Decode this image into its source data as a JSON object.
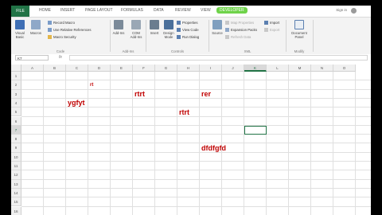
{
  "tabs": [
    "FILE",
    "HOME",
    "INSERT",
    "PAGE LAYOUT",
    "FORMULAS",
    "DATA",
    "REVIEW",
    "VIEW",
    "DEVELOPER"
  ],
  "account": {
    "signin": "Sign in"
  },
  "ribbon": {
    "code": {
      "visual_basic": "Visual Basic",
      "macros": "Macros",
      "record_macro": "Record Macro",
      "relative_refs": "Use Relative References",
      "macro_security": "Macro Security",
      "group": "Code"
    },
    "addins": {
      "addins": "Add-Ins",
      "com_addins": "COM Add-Ins",
      "group": "Add-Ins"
    },
    "controls": {
      "insert": "Insert",
      "design_mode": "Design Mode",
      "properties": "Properties",
      "view_code": "View Code",
      "run_dialog": "Run Dialog",
      "group": "Controls"
    },
    "xml": {
      "source": "Source",
      "map_properties": "Map Properties",
      "expansion_packs": "Expansion Packs",
      "refresh_data": "Refresh Data",
      "import": "Import",
      "export": "Export",
      "group": "XML"
    },
    "modify": {
      "document_panel": "Document Panel",
      "group": "Modify"
    }
  },
  "formula_bar": {
    "name_box": "K7",
    "fx": "fx",
    "value": ""
  },
  "grid": {
    "columns": [
      "A",
      "B",
      "C",
      "D",
      "E",
      "F",
      "G",
      "H",
      "I",
      "J",
      "K",
      "L",
      "M",
      "N",
      "O"
    ],
    "rows": [
      "1",
      "2",
      "3",
      "4",
      "5",
      "6",
      "7",
      "8",
      "9",
      "10",
      "11",
      "12",
      "13",
      "14",
      "15",
      "16"
    ],
    "selected": {
      "column": "K",
      "row": "7"
    },
    "cells": [
      {
        "col": "D",
        "row": "2",
        "text": "rt",
        "size": "small"
      },
      {
        "col": "F",
        "row": "3",
        "text": "rtrt",
        "size": "big"
      },
      {
        "col": "I",
        "row": "3",
        "text": "rer",
        "size": "big"
      },
      {
        "col": "C",
        "row": "4",
        "text": "ygfyt",
        "size": "big"
      },
      {
        "col": "H",
        "row": "5",
        "text": "rtrt",
        "size": "big"
      },
      {
        "col": "I",
        "row": "9",
        "text": "dfdfgfd",
        "size": "big"
      }
    ]
  }
}
